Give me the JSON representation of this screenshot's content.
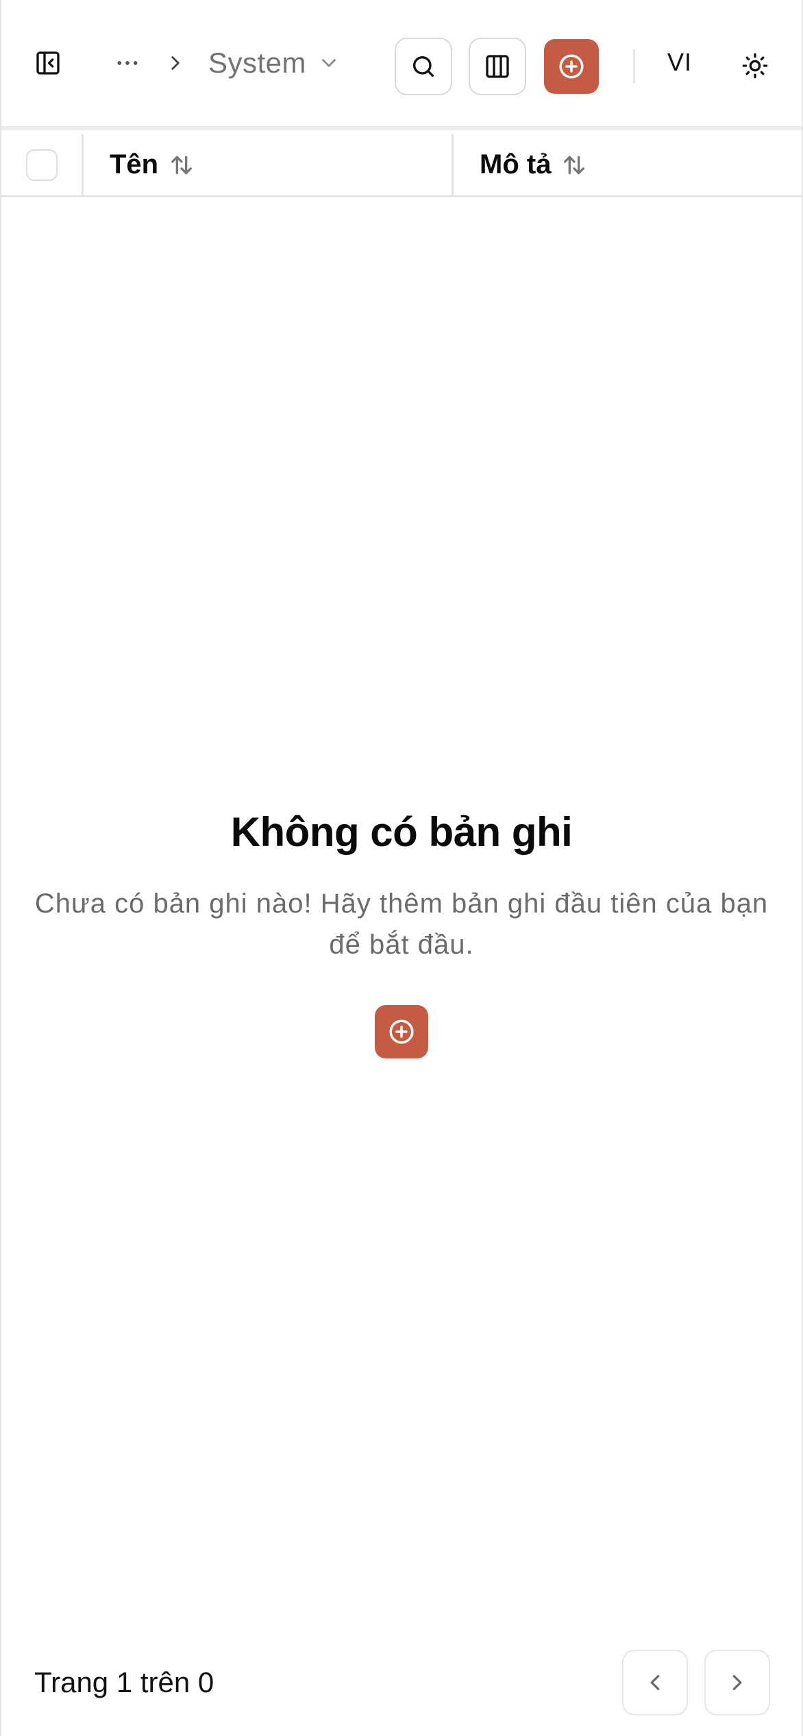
{
  "header": {
    "breadcrumb": {
      "current": "System"
    },
    "language": "VI",
    "accent_color": "#c65b43"
  },
  "table": {
    "columns": [
      {
        "label": "Tên"
      },
      {
        "label": "Mô tả"
      }
    ]
  },
  "empty_state": {
    "title": "Không có bản ghi",
    "description": "Chưa có bản ghi nào! Hãy thêm bản ghi đầu tiên của bạn để bắt đầu."
  },
  "pagination": {
    "info": "Trang 1 trên 0"
  },
  "icons": {
    "sidebar_toggle": "sidebar-toggle-icon",
    "more": "ellipsis-icon",
    "separator": "chevron-right-icon",
    "dropdown": "chevron-down-icon",
    "search": "search-icon",
    "columns": "columns-icon",
    "add": "plus-circle-icon",
    "theme": "sun-icon",
    "sort": "sort-icon",
    "prev": "chevron-left-icon",
    "next": "chevron-right-icon"
  }
}
